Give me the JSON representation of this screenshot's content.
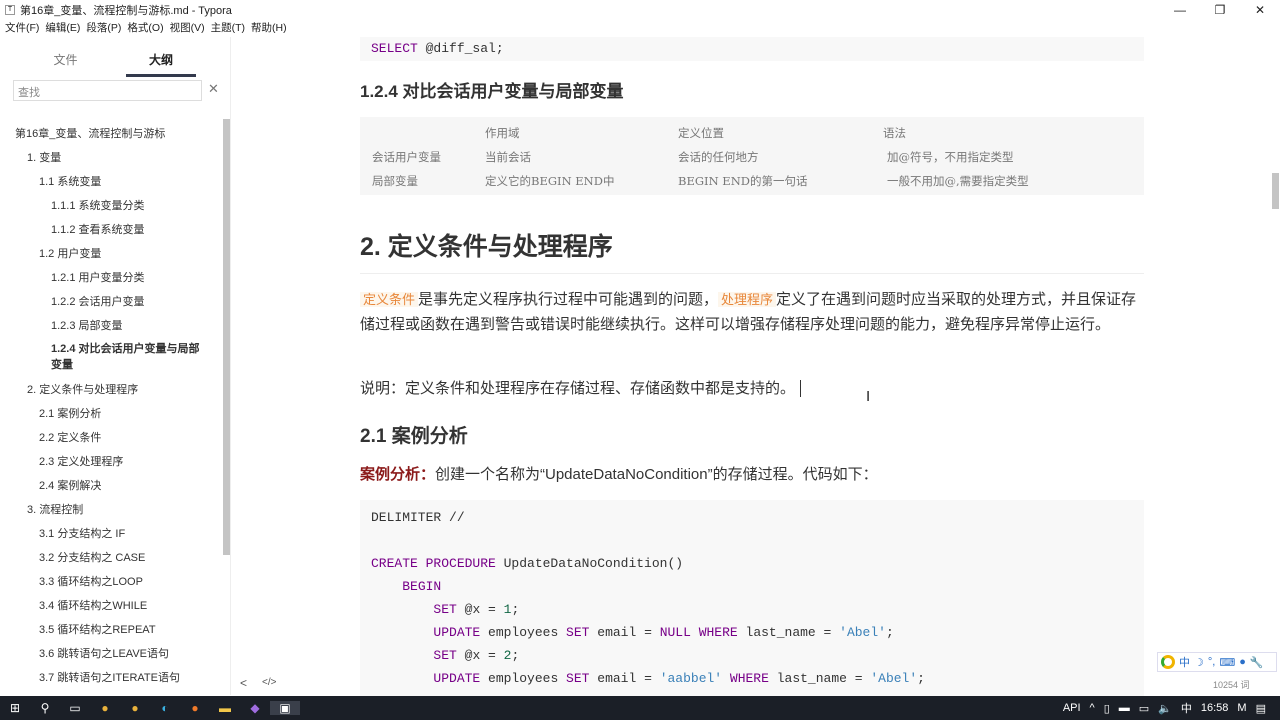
{
  "window": {
    "title": "第16章_变量、流程控制与游标.md - Typora",
    "app_icon": "T"
  },
  "menu": [
    "文件(F)",
    "编辑(E)",
    "段落(P)",
    "格式(O)",
    "视图(V)",
    "主题(T)",
    "帮助(H)"
  ],
  "sidebar": {
    "tabs": [
      "文件",
      "大纲"
    ],
    "search_placeholder": "查找",
    "outline": [
      {
        "label": "第16章_变量、流程控制与游标",
        "level": 0
      },
      {
        "label": "1. 变量",
        "level": 1
      },
      {
        "label": "1.1 系统变量",
        "level": 2
      },
      {
        "label": "1.1.1 系统变量分类",
        "level": 3
      },
      {
        "label": "1.1.2 查看系统变量",
        "level": 3
      },
      {
        "label": "1.2 用户变量",
        "level": 2
      },
      {
        "label": "1.2.1 用户变量分类",
        "level": 3
      },
      {
        "label": "1.2.2 会话用户变量",
        "level": 3
      },
      {
        "label": "1.2.3 局部变量",
        "level": 3
      },
      {
        "label": "1.2.4 对比会话用户变量与局部变量",
        "level": 3,
        "active": true
      },
      {
        "label": "2. 定义条件与处理程序",
        "level": 1
      },
      {
        "label": "2.1 案例分析",
        "level": 2
      },
      {
        "label": "2.2 定义条件",
        "level": 2
      },
      {
        "label": "2.3 定义处理程序",
        "level": 2
      },
      {
        "label": "2.4 案例解决",
        "level": 2
      },
      {
        "label": "3. 流程控制",
        "level": 1
      },
      {
        "label": "3.1 分支结构之 IF",
        "level": 2
      },
      {
        "label": "3.2 分支结构之 CASE",
        "level": 2
      },
      {
        "label": "3.3 循环结构之LOOP",
        "level": 2
      },
      {
        "label": "3.4 循环结构之WHILE",
        "level": 2
      },
      {
        "label": "3.5 循环结构之REPEAT",
        "level": 2
      },
      {
        "label": "3.6 跳转语句之LEAVE语句",
        "level": 2
      },
      {
        "label": "3.7 跳转语句之ITERATE语句",
        "level": 2
      }
    ],
    "bottom": {
      "back": "<",
      "source": "</>"
    }
  },
  "doc": {
    "code_top": [
      [
        "kw",
        "SELECT "
      ],
      [
        "",
        "@diff_sal;"
      ]
    ],
    "h_124": "1.2.4 对比会话用户变量与局部变量",
    "table": {
      "headers": [
        "",
        "作用域",
        "定义位置",
        "语法"
      ],
      "rows": [
        [
          "会话用户变量",
          "当前会话",
          "会话的任何地方",
          "加@符号，不用指定类型"
        ],
        [
          "局部变量",
          "定义它的BEGIN END中",
          "BEGIN END的第一句话",
          "一般不用加@,需要指定类型"
        ]
      ]
    },
    "h2": "2. 定义条件与处理程序",
    "p1": {
      "hl1": "定义条件",
      "t1": "是事先定义程序执行过程中可能遇到的问题，",
      "hl2": "处理程序",
      "t2": "定义了在遇到问题时应当采取的处理方式，并且保证存储过程或函数在遇到警告或错误时能继续执行。这样可以增强存储程序处理问题的能力，避免程序异常停止运行。"
    },
    "p2": "说明：定义条件和处理程序在存储过程、存储函数中都是支持的。",
    "h_21": "2.1 案例分析",
    "p3": {
      "label": "案例分析：",
      "text": "创建一个名称为“UpdateDataNoCondition”的存储过程。代码如下："
    },
    "code": [
      [
        [
          "",
          "DELIMITER //"
        ]
      ],
      [],
      [
        [
          "kw",
          "CREATE PROCEDURE "
        ],
        [
          "",
          "UpdateDataNoCondition()"
        ]
      ],
      [
        [
          "",
          "    "
        ],
        [
          "kw",
          "BEGIN"
        ]
      ],
      [
        [
          "",
          "        "
        ],
        [
          "kw",
          "SET "
        ],
        [
          "",
          "@x = "
        ],
        [
          "num",
          "1"
        ],
        [
          "",
          ";"
        ]
      ],
      [
        [
          "",
          "        "
        ],
        [
          "kw",
          "UPDATE "
        ],
        [
          "",
          "employees "
        ],
        [
          "kw",
          "SET "
        ],
        [
          "",
          "email = "
        ],
        [
          "kw",
          "NULL WHERE "
        ],
        [
          "",
          "last_name = "
        ],
        [
          "str",
          "'Abel'"
        ],
        [
          "",
          ";"
        ]
      ],
      [
        [
          "",
          "        "
        ],
        [
          "kw",
          "SET "
        ],
        [
          "",
          "@x = "
        ],
        [
          "num",
          "2"
        ],
        [
          "",
          ";"
        ]
      ],
      [
        [
          "",
          "        "
        ],
        [
          "kw",
          "UPDATE "
        ],
        [
          "",
          "employees "
        ],
        [
          "kw",
          "SET "
        ],
        [
          "",
          "email = "
        ],
        [
          "str",
          "'aabbel' "
        ],
        [
          "kw",
          "WHERE "
        ],
        [
          "",
          "last_name = "
        ],
        [
          "str",
          "'Abel'"
        ],
        [
          "",
          ";"
        ]
      ]
    ]
  },
  "status": {
    "word_count": "10254 词"
  },
  "ime": {
    "lang": "中"
  },
  "taskbar": {
    "tray_api": "API",
    "ime": "中",
    "time": "16:58"
  }
}
